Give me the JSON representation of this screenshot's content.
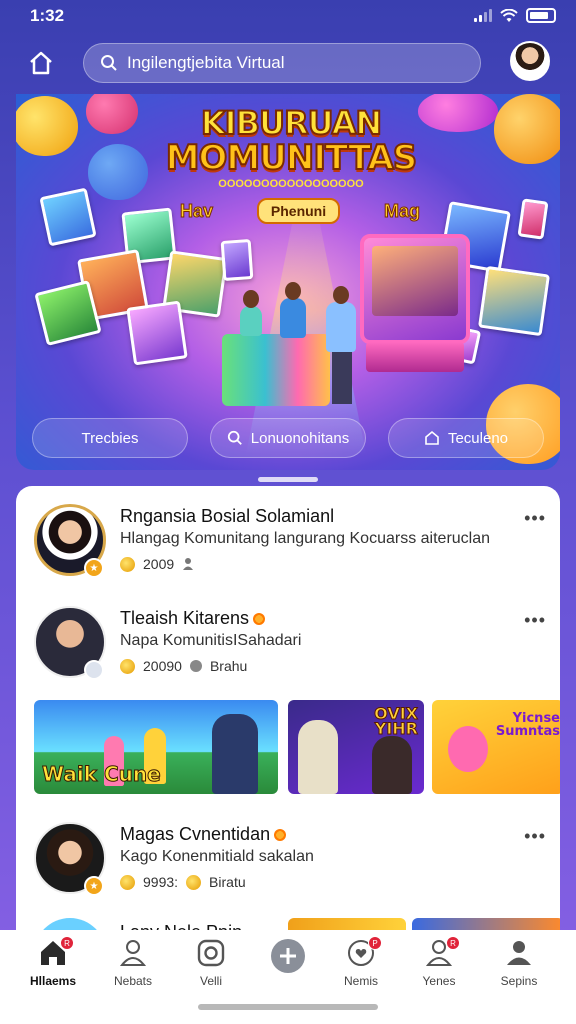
{
  "status_bar": {
    "time": "1:32"
  },
  "header": {
    "search_text": "Ingilengtjebita Virtual"
  },
  "banner": {
    "title_line1": "KIBURUAN",
    "title_line2": "MOMUNITTAS",
    "subtitle": "OOOOOOOOOOOOOOOOO",
    "word_left": "Hav",
    "pill": "Phenuni",
    "word_right": "Mag",
    "buttons": [
      {
        "label": "Trecbies"
      },
      {
        "label": "Lonuonohitans"
      },
      {
        "label": "Teculeno"
      }
    ]
  },
  "feed": {
    "groups": [
      {
        "name": "Rngansia Bosial Solamianl",
        "description": "Hlangag Komunitang langurang Kocuarss aiteruclan",
        "count": "2009"
      },
      {
        "name": "Tleaish Kitarens",
        "description": "Napa KomunitisISahadari",
        "count": "20090",
        "extra": "Brahu"
      },
      {
        "name": "Magas Cvnentidan",
        "description": "Kago Konenmitiald sakalan",
        "count": "9993:",
        "extra": "Biratu"
      }
    ],
    "tiles": [
      {
        "label": "Waik Cune"
      },
      {
        "label": "OVIX YIHR"
      },
      {
        "label": "Yicnse Sumntas"
      }
    ],
    "partial_name": "Lany Nele Pnin"
  },
  "bottom_nav": {
    "items": [
      {
        "label": "Hllaems",
        "badge": "R"
      },
      {
        "label": "Nebats",
        "badge": ""
      },
      {
        "label": "Velli",
        "badge": ""
      },
      {
        "label": "",
        "badge": ""
      },
      {
        "label": "Nemis",
        "badge": "P"
      },
      {
        "label": "Yenes",
        "badge": "R"
      },
      {
        "label": "Sepins",
        "badge": ""
      }
    ]
  }
}
